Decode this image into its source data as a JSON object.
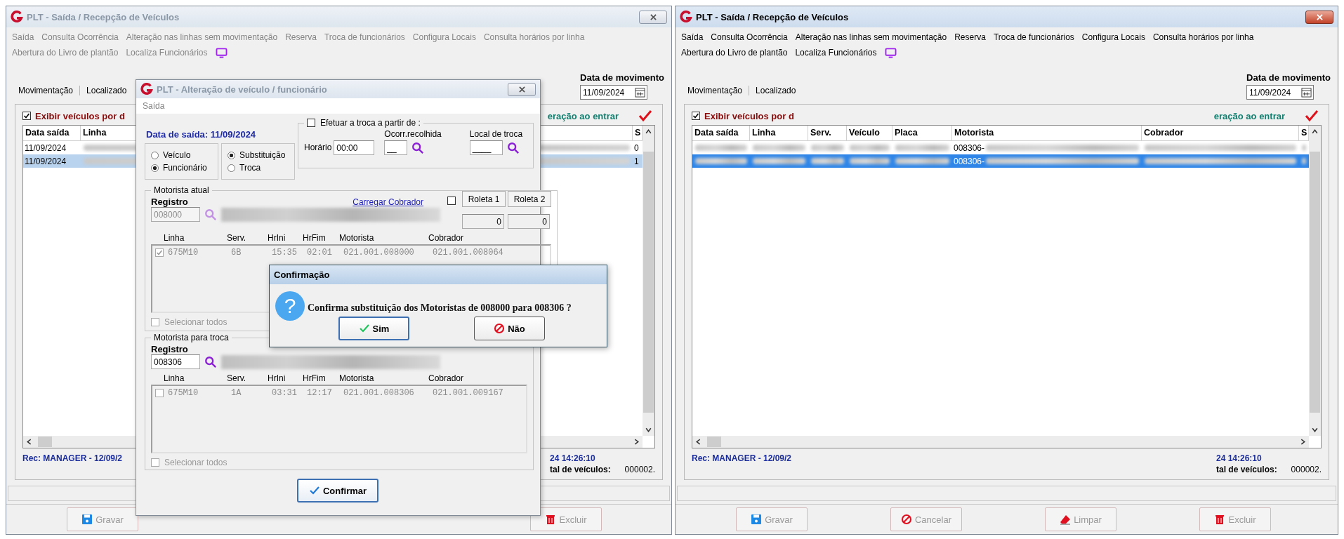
{
  "windows": [
    {
      "title": "PLT - Saída / Recepção de Veículos",
      "active": false,
      "menu_rows": [
        [
          {
            "label": "Saída"
          },
          {
            "label": "Consulta Ocorrência"
          },
          {
            "label": "Alteração nas linhas sem movimentação"
          },
          {
            "label": "Reserva"
          },
          {
            "label": "Troca de funcionários"
          },
          {
            "label": "Configura Locais"
          },
          {
            "label": "Consulta horários por linha"
          }
        ],
        [
          {
            "label": "Abertura do Livro de plantão"
          },
          {
            "label": "Localiza Funcionários"
          }
        ]
      ],
      "tabs": [
        {
          "label": "Movimentação"
        },
        {
          "label": "Localizado"
        }
      ],
      "date": {
        "label": "Data de movimento",
        "value": "11/09/2024"
      },
      "filter": {
        "label": "Exibir veículos por d",
        "checked": true
      },
      "hint": "eração ao entrar",
      "table": {
        "columns": [
          {
            "label": "Data saída"
          },
          {
            "label": "Linha"
          },
          {
            "label": "S"
          }
        ],
        "rows": [
          {
            "selected": false,
            "cells": [
              {
                "text": "11/09/2024",
                "blurred": false
              },
              {
                "blurred": true
              },
              {
                "text": "0",
                "blurred": false
              }
            ]
          },
          {
            "selected": true,
            "cells": [
              {
                "text": "11/09/2024",
                "blurred": false
              },
              {
                "blurred": true
              },
              {
                "text": "1",
                "blurred": false
              }
            ]
          }
        ]
      },
      "record": "Rec: MANAGER - 12/09/2",
      "timestamp": "24 14:26:10",
      "total_label": "tal de veículos:",
      "total_value": "000002.",
      "buttons": [
        {
          "label": "Gravar",
          "kind": "save",
          "disabled": true
        },
        {
          "label": "Excluir",
          "kind": "delete",
          "disabled": true
        }
      ],
      "dialog": {
        "title": "PLT - Alteração de veículo / funcionário",
        "menu": [
          {
            "label": "Saída"
          }
        ],
        "date_label": "Data de saída: 11/09/2024",
        "mode": [
          {
            "label": "Veículo",
            "selected": false
          },
          {
            "label": "Funcionário",
            "selected": true
          }
        ],
        "action": [
          {
            "label": "Substituição",
            "selected": true
          },
          {
            "label": "Troca",
            "selected": false
          }
        ],
        "schedule": {
          "label": "Efetuar a troca a partir de :",
          "checked": false,
          "time_label": "Horário",
          "time_value": "00:00",
          "occurrence_label": "Ocorr.recolhida",
          "occurrence_value": "__",
          "place_label": "Local de troca",
          "place_value": "____"
        },
        "groups": [
          {
            "legend": "Motorista atual",
            "registro_label": "Registro",
            "registro_value": "008000",
            "disabled": true,
            "link": "Carregar Cobrador",
            "roleta_checked": false,
            "roletas": [
              {
                "label": "Roleta 1",
                "value": "0"
              },
              {
                "label": "Roleta 2",
                "value": "0"
              }
            ],
            "columns": [
              "Linha",
              "Serv.",
              "HrIni",
              "HrFim",
              "Motorista",
              "Cobrador"
            ],
            "rows": [
              {
                "checked": true,
                "cells": [
                  "675M10",
                  "6B",
                  "15:35",
                  "02:01",
                  "021.001.008000",
                  "021.001.008064"
                ]
              }
            ],
            "select_all": {
              "label": "Selecionar todos",
              "checked": false
            }
          },
          {
            "legend": "Motorista para troca",
            "registro_label": "Registro",
            "registro_value": "008306",
            "disabled": false,
            "columns": [
              "Linha",
              "Serv.",
              "HrIni",
              "HrFim",
              "Motorista",
              "Cobrador"
            ],
            "rows": [
              {
                "checked": false,
                "cells": [
                  "675M10",
                  "1A",
                  "03:31",
                  "12:17",
                  "021.001.008306",
                  "021.001.009167"
                ]
              }
            ],
            "select_all": {
              "label": "Selecionar todos",
              "checked": false
            }
          }
        ],
        "confirm_button": "Confirmar"
      },
      "confirmation": {
        "title": "Confirmação",
        "icon": "?",
        "message": "Confirma substituição dos Motoristas de 008000 para 008306 ?",
        "buttons": [
          {
            "label": "Sim",
            "kind": "yes",
            "default": true
          },
          {
            "label": "Não",
            "kind": "no",
            "default": false
          }
        ]
      }
    },
    {
      "title": "PLT - Saída / Recepção de Veículos",
      "active": true,
      "menu_rows": [
        [
          {
            "label": "Saída"
          },
          {
            "label": "Consulta Ocorrência"
          },
          {
            "label": "Alteração nas linhas sem movimentação"
          },
          {
            "label": "Reserva"
          },
          {
            "label": "Troca de funcionários"
          },
          {
            "label": "Configura Locais"
          },
          {
            "label": "Consulta horários por linha"
          }
        ],
        [
          {
            "label": "Abertura do Livro de plantão"
          },
          {
            "label": "Localiza Funcionários"
          }
        ]
      ],
      "tabs": [
        {
          "label": "Movimentação"
        },
        {
          "label": "Localizado"
        }
      ],
      "date": {
        "label": "Data de movimento",
        "value": "11/09/2024"
      },
      "filter": {
        "label": "Exibir veículos por d",
        "checked": true
      },
      "hint": "eração ao entrar",
      "table": {
        "columns": [
          {
            "label": "Data saída"
          },
          {
            "label": "Linha"
          },
          {
            "label": "Serv."
          },
          {
            "label": "Veículo"
          },
          {
            "label": "Placa"
          },
          {
            "label": "Motorista"
          },
          {
            "label": "Cobrador"
          },
          {
            "label": "S"
          }
        ],
        "rows": [
          {
            "selected": false,
            "cells": [
              {
                "blurred": true
              },
              {
                "blurred": true
              },
              {
                "blurred": true
              },
              {
                "blurred": true
              },
              {
                "blurred": true
              },
              {
                "text": "008306-",
                "blurred": true
              },
              {
                "blurred": true
              },
              {
                "blurred": true
              }
            ]
          },
          {
            "selected": true,
            "cells": [
              {
                "blurred": true
              },
              {
                "blurred": true
              },
              {
                "blurred": true
              },
              {
                "blurred": true
              },
              {
                "blurred": true
              },
              {
                "text": "008306-",
                "blurred": true
              },
              {
                "blurred": true
              },
              {
                "blurred": true
              }
            ]
          }
        ]
      },
      "record": "Rec: MANAGER - 12/09/2",
      "timestamp": "24 14:26:10",
      "total_label": "tal de veículos:",
      "total_value": "000002.",
      "buttons": [
        {
          "label": "Gravar",
          "kind": "save",
          "disabled": true
        },
        {
          "label": "Cancelar",
          "kind": "cancel",
          "disabled": true
        },
        {
          "label": "Limpar",
          "kind": "clear",
          "disabled": true
        },
        {
          "label": "Excluir",
          "kind": "delete",
          "disabled": true
        }
      ]
    }
  ]
}
